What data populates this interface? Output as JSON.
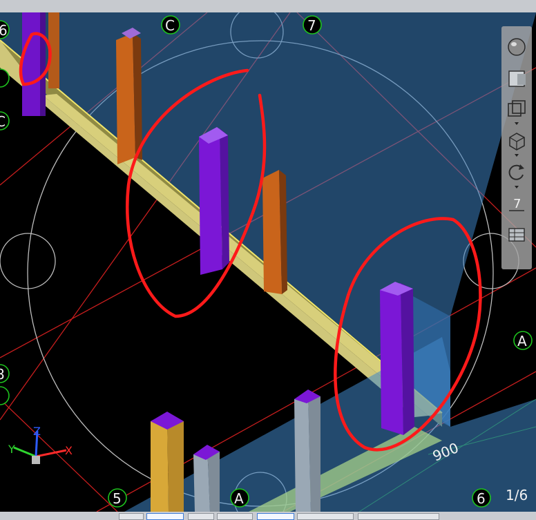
{
  "grid_labels": {
    "c": "C",
    "seven_top": "7",
    "seven_nav": "7",
    "five": "5",
    "a_bottom": "A",
    "a_right": "A",
    "six": "6",
    "six_left": "6",
    "partial_left_b": "C",
    "partial_left_c": "8"
  },
  "dimension_text": "900",
  "scale_text": "1/6",
  "ucs_labels": {
    "x": "X",
    "y": "Y",
    "z": "Z"
  },
  "nav_tools": [
    "steeringwheel-icon",
    "viewcube-icon",
    "zoom-extents-icon",
    "orbit-icon",
    "pan-icon",
    "showmotion-icon"
  ],
  "colors": {
    "background": "#000000",
    "annotation": "#ff1a1a",
    "grid_line": "#c81e1e",
    "column_purple": "#7b17d6",
    "column_orange": "#c9641b",
    "beam_yellow": "#d8cf7b",
    "wall_blue": "#4c88c8",
    "grid_bubble": "#1ec31e"
  }
}
